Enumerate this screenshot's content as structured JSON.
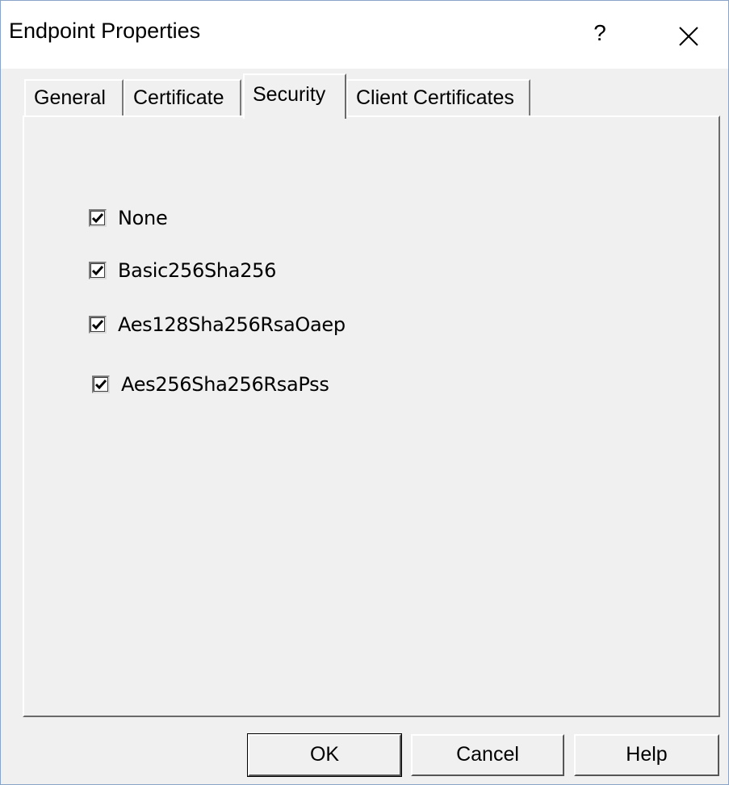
{
  "window": {
    "title": "Endpoint Properties",
    "help_label": "?"
  },
  "tabs": [
    {
      "label": "General",
      "active": false
    },
    {
      "label": "Certificate",
      "active": false
    },
    {
      "label": "Security",
      "active": true
    },
    {
      "label": "Client Certificates",
      "active": false
    }
  ],
  "security_policies": [
    {
      "label": "None",
      "checked": true
    },
    {
      "label": "Basic256Sha256",
      "checked": true
    },
    {
      "label": "Aes128Sha256RsaOaep",
      "checked": true
    },
    {
      "label": "Aes256Sha256RsaPss",
      "checked": true
    }
  ],
  "buttons": {
    "ok": "OK",
    "cancel": "Cancel",
    "help": "Help"
  }
}
